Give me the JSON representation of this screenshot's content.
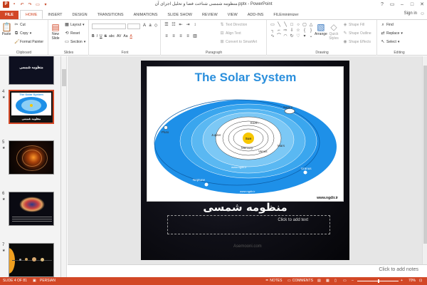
{
  "titlebar": {
    "title": "منظومه شمسی شناخت فضا و تحلیل اجزای آن.pptx - PowerPoint",
    "app_icon": "P"
  },
  "tabs": [
    {
      "label": "FILE"
    },
    {
      "label": "HOME"
    },
    {
      "label": "INSERT"
    },
    {
      "label": "DESIGN"
    },
    {
      "label": "TRANSITIONS"
    },
    {
      "label": "ANIMATIONS"
    },
    {
      "label": "SLIDE SHOW"
    },
    {
      "label": "REVIEW"
    },
    {
      "label": "VIEW"
    },
    {
      "label": "ADD-INS"
    },
    {
      "label": "FILEminimizer"
    }
  ],
  "signin": "Sign in",
  "ribbon": {
    "clipboard": {
      "label": "Clipboard",
      "paste": "Paste",
      "cut": "Cut",
      "copy": "Copy",
      "format_painter": "Format Painter"
    },
    "slides": {
      "label": "Slides",
      "new_slide_1": "New",
      "new_slide_2": "Slide",
      "layout": "Layout",
      "reset": "Reset",
      "section": "Section"
    },
    "font": {
      "label": "Font",
      "bold": "B",
      "italic": "I",
      "underline": "U",
      "strike": "S",
      "shadow": "abc",
      "spacing": "AV",
      "case": "Aa",
      "color": "A"
    },
    "paragraph": {
      "label": "Paragraph",
      "text_direction": "Text Direction",
      "align_text": "Align Text",
      "convert_smartart": "Convert to SmartArt"
    },
    "drawing": {
      "label": "Drawing",
      "arrange": "Arrange",
      "quick_styles_1": "Quick",
      "quick_styles_2": "Styles",
      "shape_fill": "Shape Fill",
      "shape_outline": "Shape Outline",
      "shape_effects": "Shape Effects"
    },
    "editing": {
      "label": "Editing",
      "find": "Find",
      "replace": "Replace",
      "select": "Select"
    }
  },
  "thumbnails": [
    {
      "num": "",
      "caption": "منظومه شمسی",
      "selected": false
    },
    {
      "num": "4",
      "caption": "منظومه شمسی",
      "title": "The Solar System",
      "selected": true
    },
    {
      "num": "5",
      "caption": "",
      "selected": false
    },
    {
      "num": "6",
      "caption": "",
      "selected": false
    },
    {
      "num": "7",
      "caption": "",
      "selected": false
    }
  ],
  "slide": {
    "image_title": "The Solar System",
    "planets": {
      "sun": "Sun",
      "mercury": "Mercury",
      "venus": "Venus",
      "earth": "Earth",
      "mars": "Mars",
      "jupiter": "Jupiter",
      "saturn": "Saturn",
      "uranus": "Uranus",
      "neptune": "Neptune",
      "pluto": "Pluto"
    },
    "credit_inner": "www.ngdir.ir",
    "credit_corner": "www.ngdir.ir",
    "title": "منظومه شمسی",
    "placeholder": "Click to add text",
    "watermark": "Asemooni.com"
  },
  "notes": {
    "placeholder": "Click to add notes"
  },
  "statusbar": {
    "slide_info": "SLIDE 4 OF 81",
    "language": "PERSIAN",
    "notes": "NOTES",
    "comments": "COMMENTS",
    "zoom": "70%"
  },
  "colors": {
    "accent": "#d24726",
    "orbit_outer": "#1e90e8",
    "orbit_light": "#8ccff5",
    "sun": "#f7c700"
  }
}
